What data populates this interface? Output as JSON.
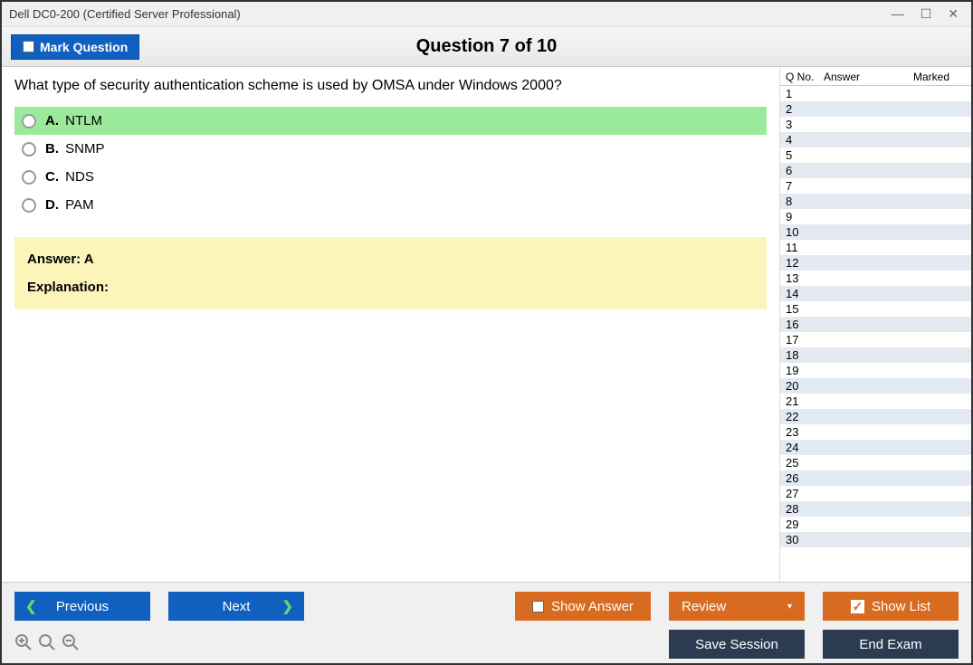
{
  "window": {
    "title": "Dell DC0-200 (Certified Server Professional)"
  },
  "header": {
    "mark_button": "Mark Question",
    "counter": "Question 7 of 10"
  },
  "question": {
    "text": "What type of security authentication scheme is used by OMSA under Windows 2000?",
    "options": [
      {
        "letter": "A.",
        "text": "NTLM",
        "correct": true
      },
      {
        "letter": "B.",
        "text": "SNMP",
        "correct": false
      },
      {
        "letter": "C.",
        "text": "NDS",
        "correct": false
      },
      {
        "letter": "D.",
        "text": "PAM",
        "correct": false
      }
    ]
  },
  "answer_box": {
    "answer_label": "Answer: ",
    "answer_value": "A",
    "explanation_label": "Explanation:",
    "explanation_text": ""
  },
  "sidebar": {
    "col_qno": "Q No.",
    "col_answer": "Answer",
    "col_marked": "Marked",
    "rows": [
      1,
      2,
      3,
      4,
      5,
      6,
      7,
      8,
      9,
      10,
      11,
      12,
      13,
      14,
      15,
      16,
      17,
      18,
      19,
      20,
      21,
      22,
      23,
      24,
      25,
      26,
      27,
      28,
      29,
      30
    ]
  },
  "footer": {
    "previous": "Previous",
    "next": "Next",
    "show_answer": "Show Answer",
    "review": "Review",
    "show_list": "Show List",
    "save_session": "Save Session",
    "end_exam": "End Exam"
  }
}
